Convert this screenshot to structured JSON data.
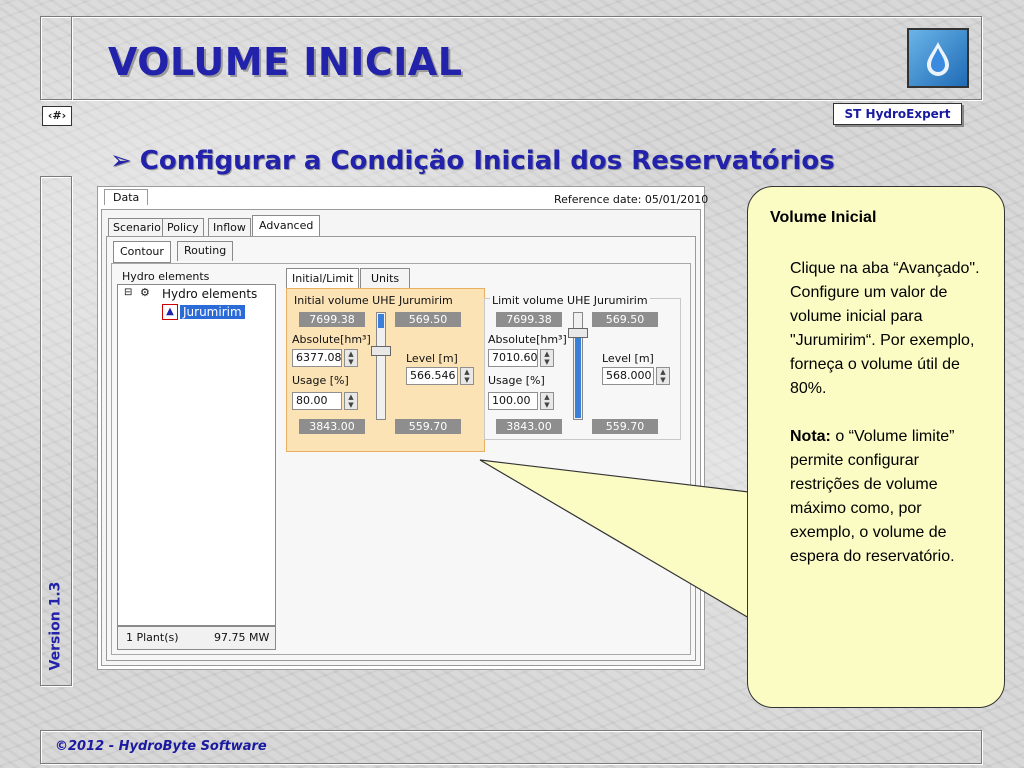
{
  "slide": {
    "title": "VOLUME INICIAL",
    "nav_label": "‹#›",
    "brand": "ST HydroExpert",
    "subtitle": "Configurar a Condição Inicial dos Reservatórios",
    "version": "Version 1.3",
    "footer": "©2012 - HydroByte Software",
    "logo_icon": "water-drop-icon"
  },
  "app": {
    "data_tab": "Data",
    "reference_date": "Reference date: 05/01/2010",
    "main_tabs": [
      "Scenario",
      "Policy",
      "Inflow",
      "Advanced"
    ],
    "active_main_tab": "Advanced",
    "sub_tabs": [
      "Contour",
      "Routing"
    ],
    "tree_title": "Hydro elements",
    "tree_root": "Hydro elements",
    "tree_child": "Jurumirim",
    "status_plants": "1 Plant(s)",
    "status_power": "97.75 MW",
    "inner_tabs": [
      "Initial/Limit",
      "Units"
    ],
    "initial": {
      "title": "Initial volume UHE Jurumirim",
      "vol_max": "7699.38",
      "level_max": "569.50",
      "absolute_label": "Absolute[hm³]",
      "absolute_value": "6377.08",
      "usage_label": "Usage [%]",
      "usage_value": "80.00",
      "level_label": "Level [m]",
      "level_value": "566.546",
      "vol_min": "3843.00",
      "level_min": "559.70"
    },
    "limit": {
      "title": "Limit volume UHE Jurumirim",
      "vol_max": "7699.38",
      "level_max": "569.50",
      "absolute_label": "Absolute[hm³]",
      "absolute_value": "7010.60",
      "usage_label": "Usage [%]",
      "usage_value": "100.00",
      "level_label": "Level [m]",
      "level_value": "568.000",
      "vol_min": "3843.00",
      "level_min": "559.70"
    }
  },
  "callout": {
    "heading": "Volume Inicial",
    "para1": "Clique na aba “Avançado\". Configure um valor de volume inicial para \"Jurumirim“. Por exemplo, forneça o volume útil de 80%.",
    "note_label": "Nota:",
    "note_text": " o “Volume limite” permite configurar restrições de volume máximo como, por exemplo, o volume de espera do reservatório."
  }
}
